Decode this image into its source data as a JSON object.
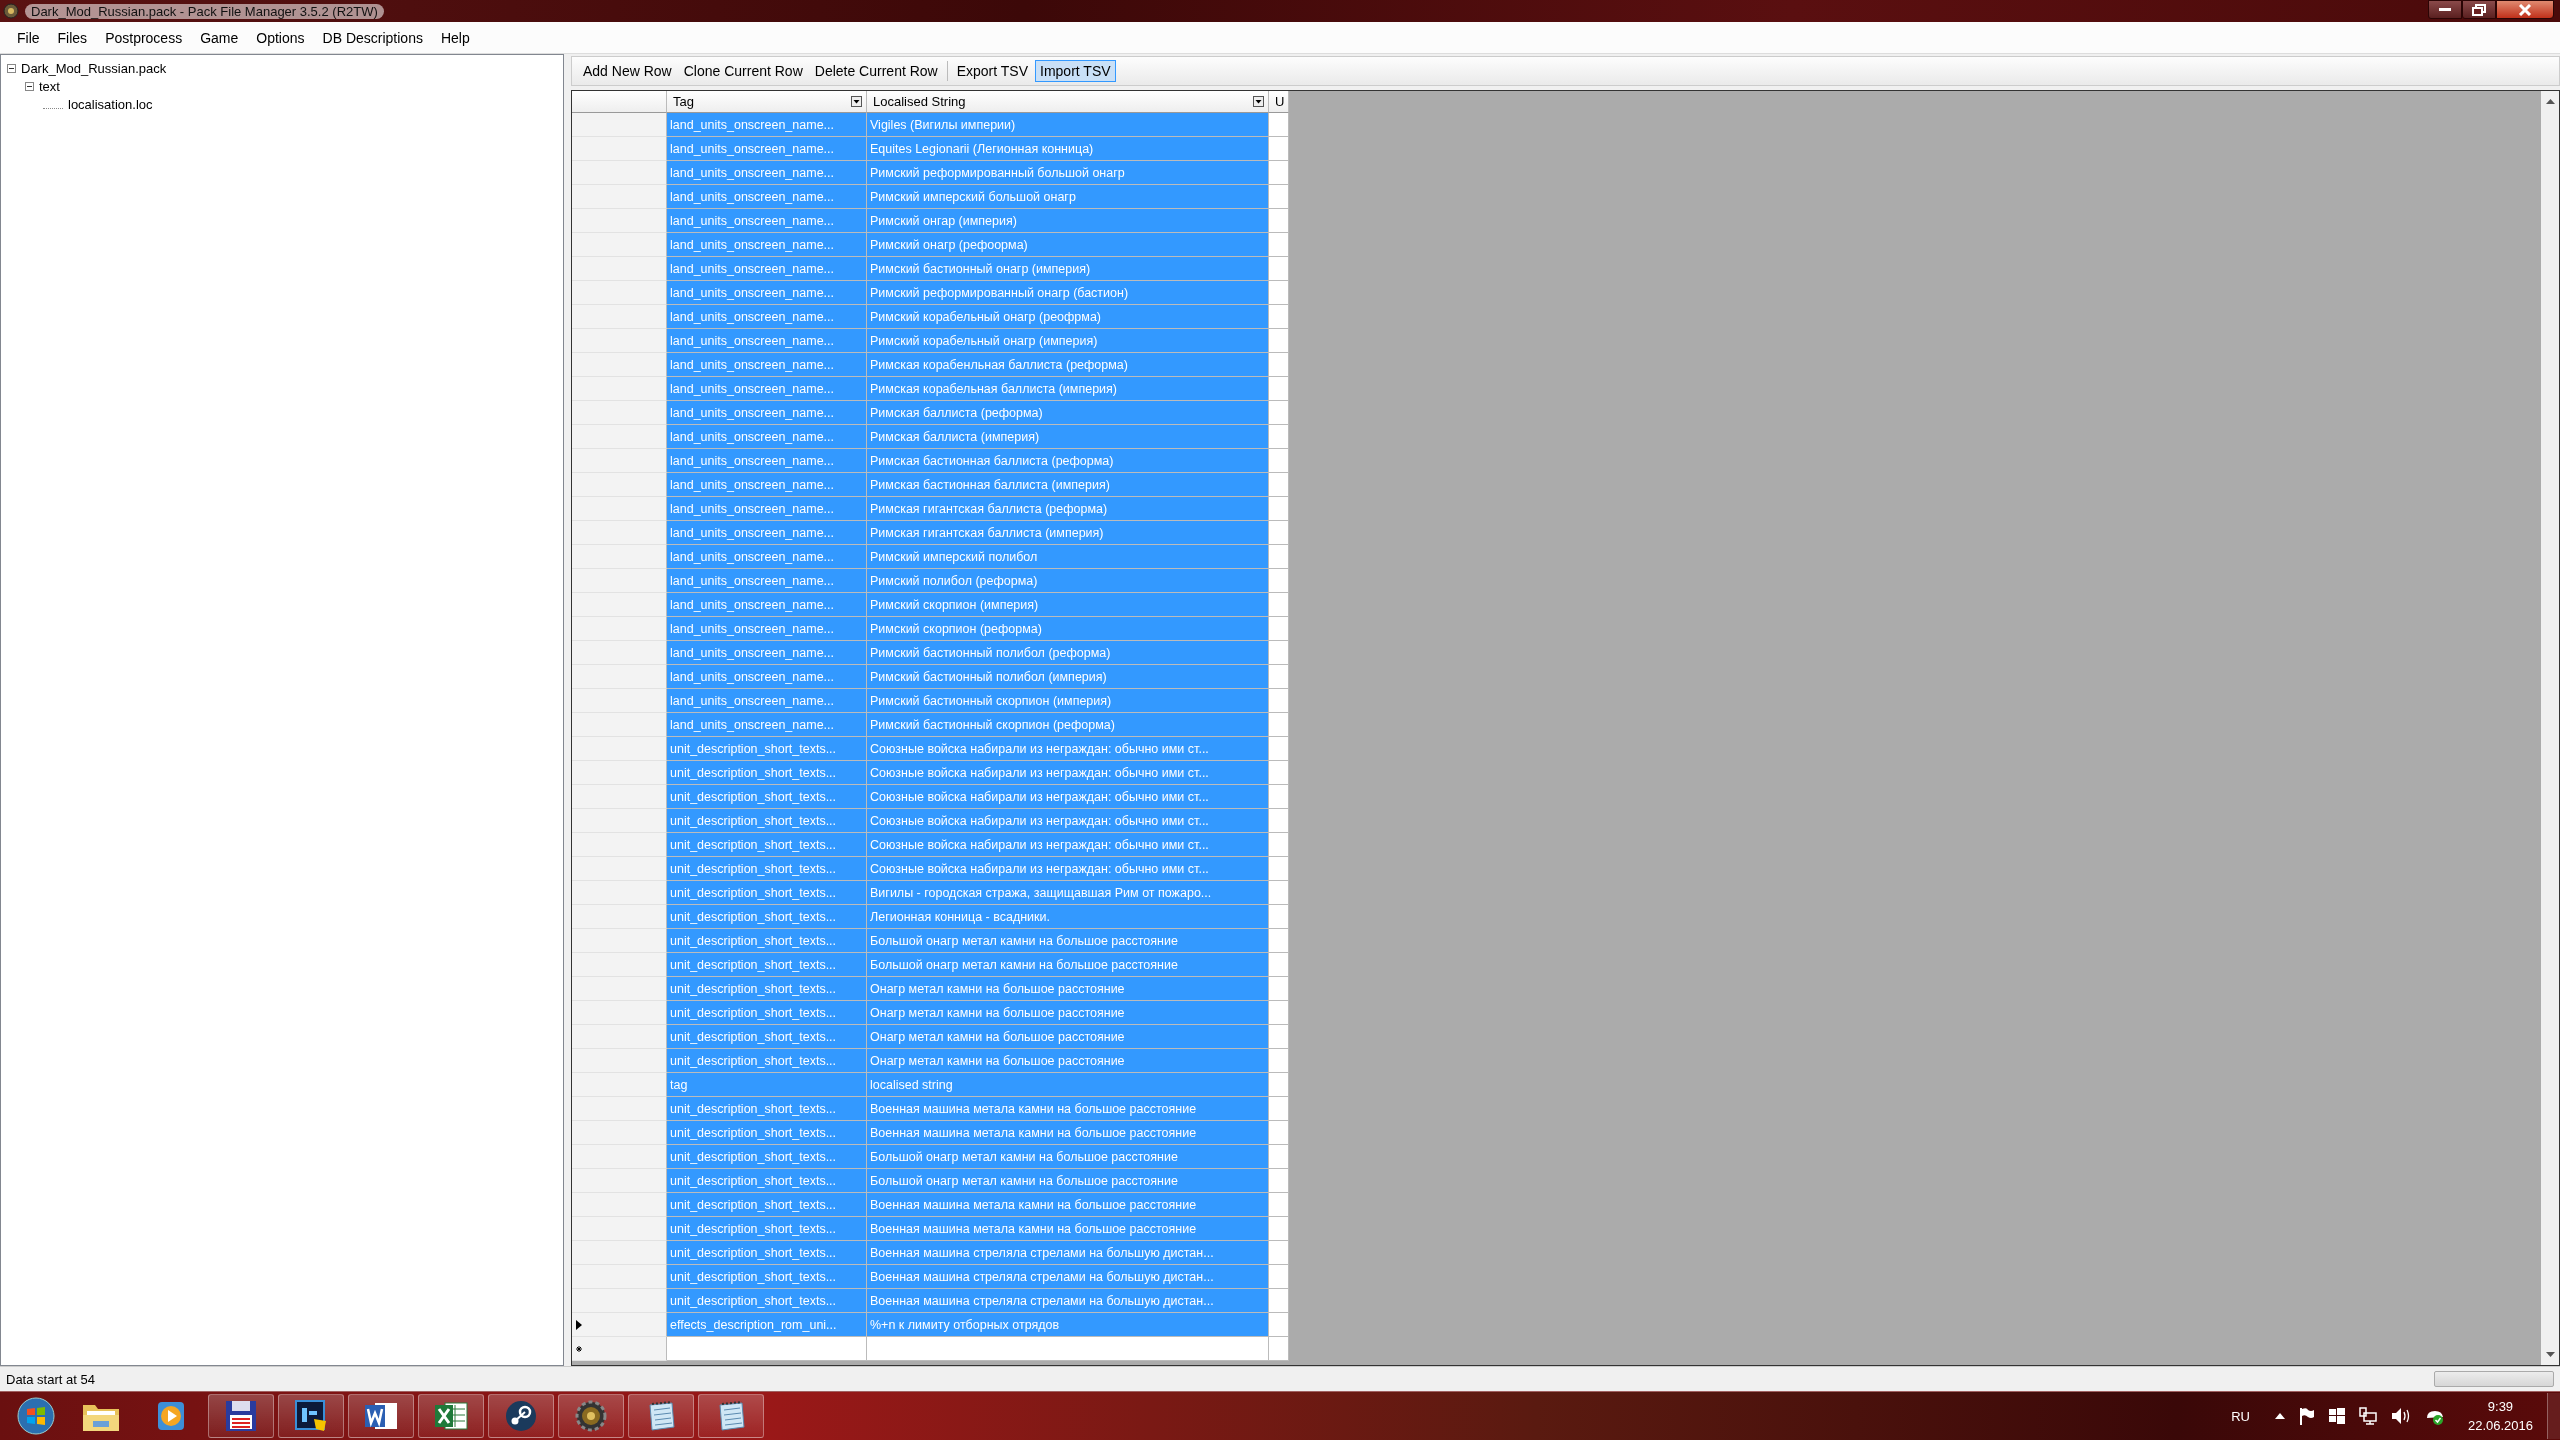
{
  "window": {
    "title": "Dark_Mod_Russian.pack - Pack File Manager 3.5.2 (R2TW)"
  },
  "menu": [
    "File",
    "Files",
    "Postprocess",
    "Game",
    "Options",
    "DB Descriptions",
    "Help"
  ],
  "tree": [
    {
      "label": "Dark_Mod_Russian.pack",
      "expanded": true,
      "children": [
        {
          "label": "text",
          "expanded": true,
          "children": [
            {
              "label": "localisation.loc"
            }
          ]
        }
      ]
    }
  ],
  "toolbar": [
    {
      "label": "Add New Row",
      "highlighted": false
    },
    {
      "label": "Clone Current Row",
      "highlighted": false
    },
    {
      "label": "Delete Current Row",
      "highlighted": false
    },
    {
      "label": "Export TSV",
      "highlighted": false
    },
    {
      "label": "Import TSV",
      "highlighted": true
    }
  ],
  "table": {
    "columns": [
      "Tag",
      "Localised String",
      "U"
    ],
    "rows": [
      {
        "tag": "land_units_onscreen_name...",
        "text": "Vigiles (Вигилы империи)",
        "selected": true
      },
      {
        "tag": "land_units_onscreen_name...",
        "text": "Equites Legionarii (Легионная конница)",
        "selected": true
      },
      {
        "tag": "land_units_onscreen_name...",
        "text": "Римский реформированный большой онагр",
        "selected": true
      },
      {
        "tag": "land_units_onscreen_name...",
        "text": "Римский имперский большой онагр",
        "selected": true
      },
      {
        "tag": "land_units_onscreen_name...",
        "text": "Римский онгар (империя)",
        "selected": true
      },
      {
        "tag": "land_units_onscreen_name...",
        "text": "Римский онагр (рефоорма)",
        "selected": true
      },
      {
        "tag": "land_units_onscreen_name...",
        "text": "Римский бастионный онагр (империя)",
        "selected": true
      },
      {
        "tag": "land_units_onscreen_name...",
        "text": "Римский реформированный онагр (бастион)",
        "selected": true
      },
      {
        "tag": "land_units_onscreen_name...",
        "text": "Римский корабельный онагр (реофрма)",
        "selected": true
      },
      {
        "tag": "land_units_onscreen_name...",
        "text": "Римский корабельный онагр (империя)",
        "selected": true
      },
      {
        "tag": "land_units_onscreen_name...",
        "text": "Римская корабенльная баллиста (реформа)",
        "selected": true
      },
      {
        "tag": "land_units_onscreen_name...",
        "text": "Римская корабельная баллиста (империя)",
        "selected": true
      },
      {
        "tag": "land_units_onscreen_name...",
        "text": "Римская баллиста (реформа)",
        "selected": true
      },
      {
        "tag": "land_units_onscreen_name...",
        "text": "Римская баллиста (империя)",
        "selected": true
      },
      {
        "tag": "land_units_onscreen_name...",
        "text": "Римская бастионная баллиста (реформа)",
        "selected": true
      },
      {
        "tag": "land_units_onscreen_name...",
        "text": "Римская бастионная баллиста (империя)",
        "selected": true
      },
      {
        "tag": "land_units_onscreen_name...",
        "text": "Римская гигантская баллиста (реформа)",
        "selected": true
      },
      {
        "tag": "land_units_onscreen_name...",
        "text": "Римская гигантская баллиста (империя)",
        "selected": true
      },
      {
        "tag": "land_units_onscreen_name...",
        "text": "Римский имперский полибол",
        "selected": true
      },
      {
        "tag": "land_units_onscreen_name...",
        "text": "Римский полибол (реформа)",
        "selected": true
      },
      {
        "tag": "land_units_onscreen_name...",
        "text": "Римский скорпион (империя)",
        "selected": true
      },
      {
        "tag": "land_units_onscreen_name...",
        "text": "Римский скорпион (реформа)",
        "selected": true
      },
      {
        "tag": "land_units_onscreen_name...",
        "text": "Римский бастионный полибол (реформа)",
        "selected": true
      },
      {
        "tag": "land_units_onscreen_name...",
        "text": "Римский бастионный полибол (империя)",
        "selected": true
      },
      {
        "tag": "land_units_onscreen_name...",
        "text": "Римский бастионный скорпион (империя)",
        "selected": true
      },
      {
        "tag": "land_units_onscreen_name...",
        "text": "Римский бастионный скорпион (реформа)",
        "selected": true
      },
      {
        "tag": "unit_description_short_texts...",
        "text": "Союзные войска набирали из неграждан: обычно ими ст...",
        "selected": true
      },
      {
        "tag": "unit_description_short_texts...",
        "text": "Союзные войска набирали из неграждан: обычно ими ст...",
        "selected": true
      },
      {
        "tag": "unit_description_short_texts...",
        "text": "Союзные войска набирали из неграждан: обычно ими ст...",
        "selected": true
      },
      {
        "tag": "unit_description_short_texts...",
        "text": "Союзные войска набирали из неграждан: обычно ими ст...",
        "selected": true
      },
      {
        "tag": "unit_description_short_texts...",
        "text": "Союзные войска набирали из неграждан: обычно ими ст...",
        "selected": true
      },
      {
        "tag": "unit_description_short_texts...",
        "text": "Союзные войска набирали из неграждан: обычно ими ст...",
        "selected": true
      },
      {
        "tag": "unit_description_short_texts...",
        "text": "Вигилы - городская стража, защищавшая Рим от пожаро...",
        "selected": true
      },
      {
        "tag": "unit_description_short_texts...",
        "text": "Легионная конница - всадники.",
        "selected": true
      },
      {
        "tag": "unit_description_short_texts...",
        "text": "Большой онагр метал камни на большое расстояние",
        "selected": true
      },
      {
        "tag": "unit_description_short_texts...",
        "text": "Большой онагр метал камни на большое расстояние",
        "selected": true
      },
      {
        "tag": "unit_description_short_texts...",
        "text": "Онагр метал камни на большое расстояние",
        "selected": true
      },
      {
        "tag": "unit_description_short_texts...",
        "text": "Онагр метал камни на большое расстояние",
        "selected": true
      },
      {
        "tag": "unit_description_short_texts...",
        "text": "Онагр метал камни на большое расстояние",
        "selected": true
      },
      {
        "tag": "unit_description_short_texts...",
        "text": "Онагр метал камни на большое расстояние",
        "selected": true
      },
      {
        "tag": "tag",
        "text": "localised string",
        "selected": true
      },
      {
        "tag": "unit_description_short_texts...",
        "text": "Военная машина метала камни на большое расстояние",
        "selected": true
      },
      {
        "tag": "unit_description_short_texts...",
        "text": "Военная машина метала камни на большое расстояние",
        "selected": true
      },
      {
        "tag": "unit_description_short_texts...",
        "text": "Большой онагр метал камни на большое расстояние",
        "selected": true
      },
      {
        "tag": "unit_description_short_texts...",
        "text": "Большой онагр метал камни на большое расстояние",
        "selected": true
      },
      {
        "tag": "unit_description_short_texts...",
        "text": "Военная машина метала камни на большое расстояние",
        "selected": true
      },
      {
        "tag": "unit_description_short_texts...",
        "text": "Военная машина метала камни на большое расстояние",
        "selected": true
      },
      {
        "tag": "unit_description_short_texts...",
        "text": "Военная машина стреляла стрелами на большую дистан...",
        "selected": true
      },
      {
        "tag": "unit_description_short_texts...",
        "text": "Военная машина стреляла стрелами на большую дистан...",
        "selected": true
      },
      {
        "tag": "unit_description_short_texts...",
        "text": "Военная машина стреляла стрелами на большую дистан...",
        "selected": true
      },
      {
        "tag": "effects_description_rom_uni...",
        "text": "%+n  к лимиту отборных отрядов",
        "selected": true,
        "current": true
      },
      {
        "selected": false,
        "new_row": true
      }
    ]
  },
  "status_bar": {
    "text": "Data start at 54",
    "progress": {
      "level": 0
    }
  },
  "taskbar": {
    "apps": [
      {
        "kind": "folder",
        "running": false
      },
      {
        "kind": "media",
        "running": false
      },
      {
        "kind": "floppy",
        "running": true
      },
      {
        "kind": "photo",
        "running": true
      },
      {
        "kind": "document",
        "running": true
      },
      {
        "kind": "spreadsheet",
        "running": true
      },
      {
        "kind": "steam",
        "running": true
      },
      {
        "kind": "gear",
        "running": true
      },
      {
        "kind": "notepad",
        "running": true
      },
      {
        "kind": "notepad",
        "running": true
      }
    ],
    "language": "RU",
    "time": "9:39",
    "date": "22.06.2016"
  }
}
